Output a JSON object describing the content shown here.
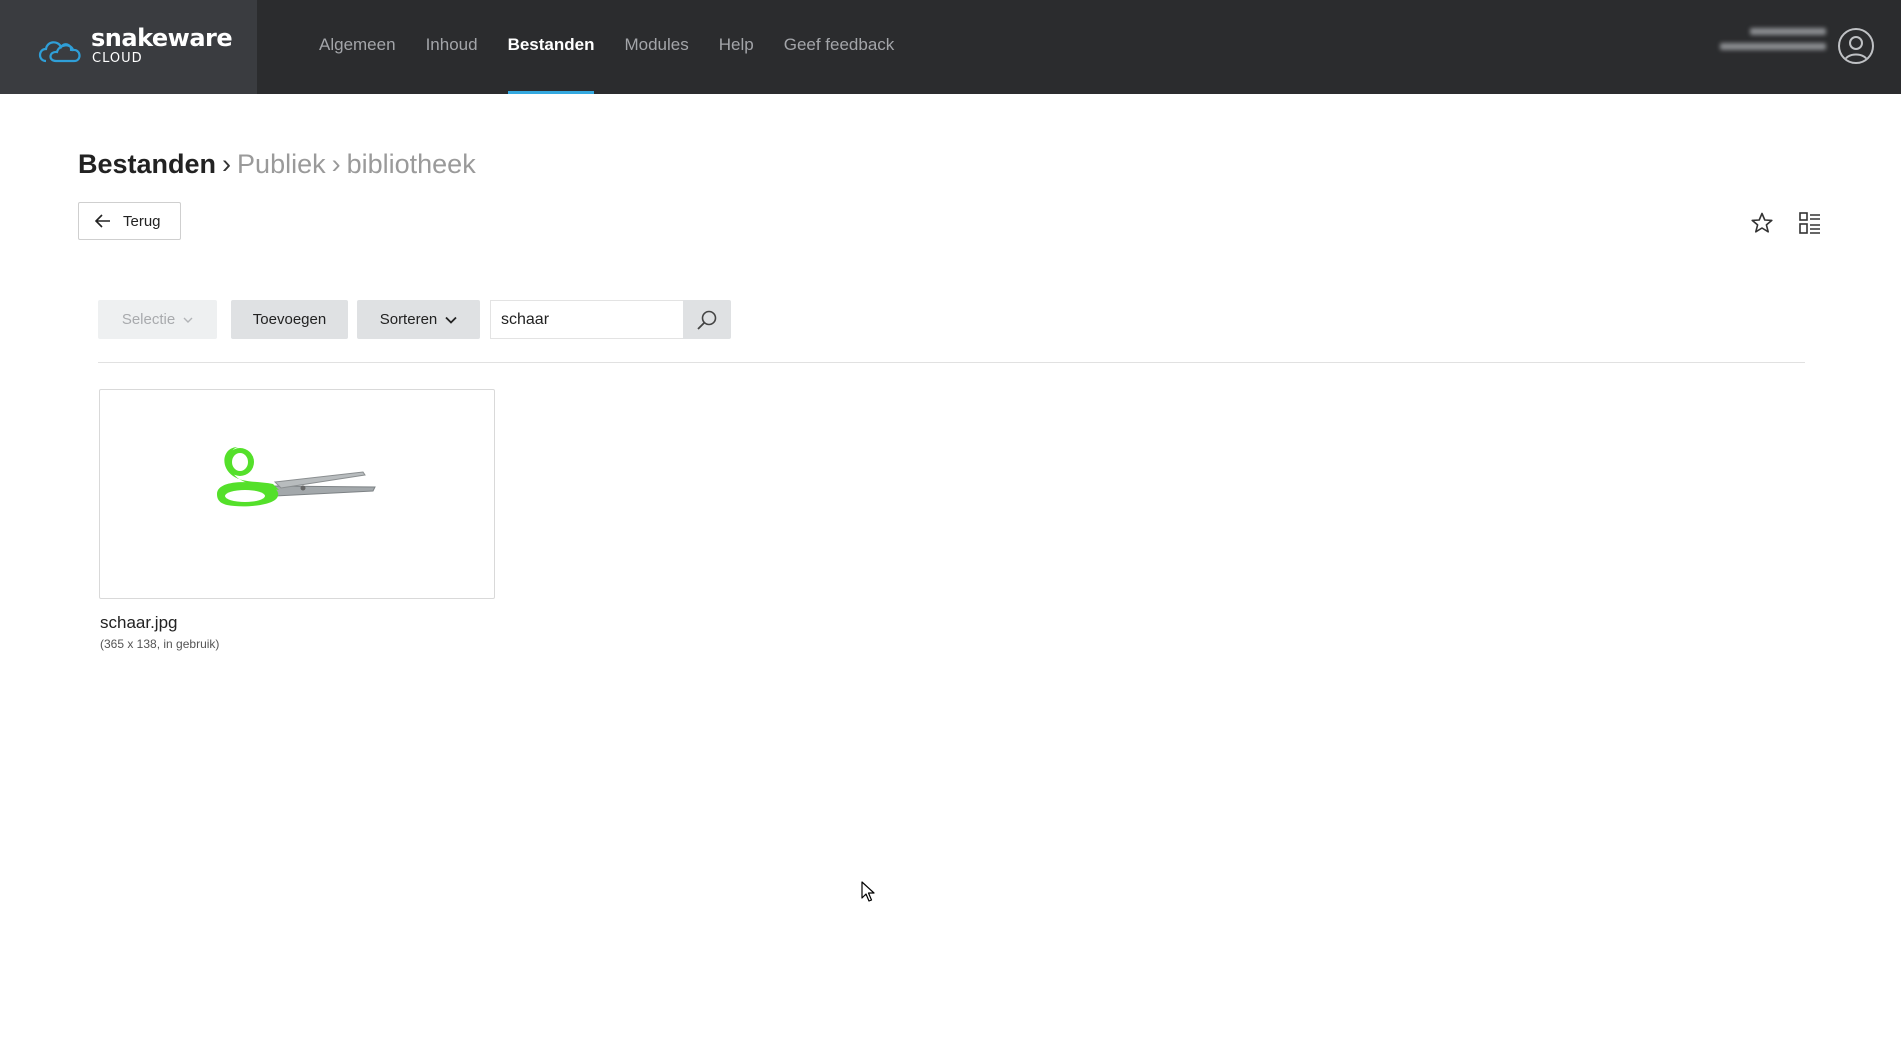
{
  "app": {
    "logo_name": "snakeware",
    "logo_sub": "CLOUD"
  },
  "nav": {
    "items": [
      {
        "label": "Algemeen"
      },
      {
        "label": "Inhoud"
      },
      {
        "label": "Bestanden",
        "active": true
      },
      {
        "label": "Modules"
      },
      {
        "label": "Help"
      },
      {
        "label": "Geef feedback"
      }
    ]
  },
  "breadcrumb": {
    "root": "Bestanden",
    "sep": "›",
    "path": [
      "Publiek",
      "bibliotheek"
    ]
  },
  "back": {
    "label": "Terug"
  },
  "toolbar": {
    "select_label": "Selectie",
    "add_label": "Toevoegen",
    "sort_label": "Sorteren"
  },
  "search": {
    "value": "schaar"
  },
  "files": [
    {
      "name": "schaar.jpg",
      "meta": "(365 x 138, in gebruik)",
      "icon": "scissors"
    }
  ],
  "colors": {
    "topbar": "#2b2c2e",
    "accent": "#34a9e0",
    "scissors_handle": "#54e02a"
  }
}
